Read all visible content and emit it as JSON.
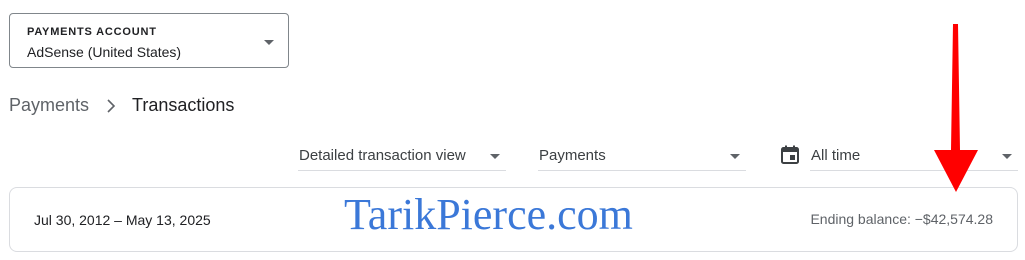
{
  "account": {
    "label": "PAYMENTS ACCOUNT",
    "value": "AdSense (United States)"
  },
  "breadcrumb": {
    "parent": "Payments",
    "separator": "›",
    "current": "Transactions"
  },
  "filters": {
    "view": "Detailed transaction view",
    "type": "Payments",
    "date": "All time"
  },
  "summary": {
    "date_range": "Jul 30, 2012 – May 13, 2025",
    "ending_balance": "Ending balance: −$42,574.28"
  },
  "watermark": {
    "text": "TarikPierce.com",
    "color": "#3b78d8"
  },
  "annotation": {
    "arrow_color": "#ff0000",
    "icon": "red-down-arrow"
  },
  "colors": {
    "text_primary": "#202124",
    "text_secondary": "#5f6368",
    "border": "#dadce0"
  }
}
